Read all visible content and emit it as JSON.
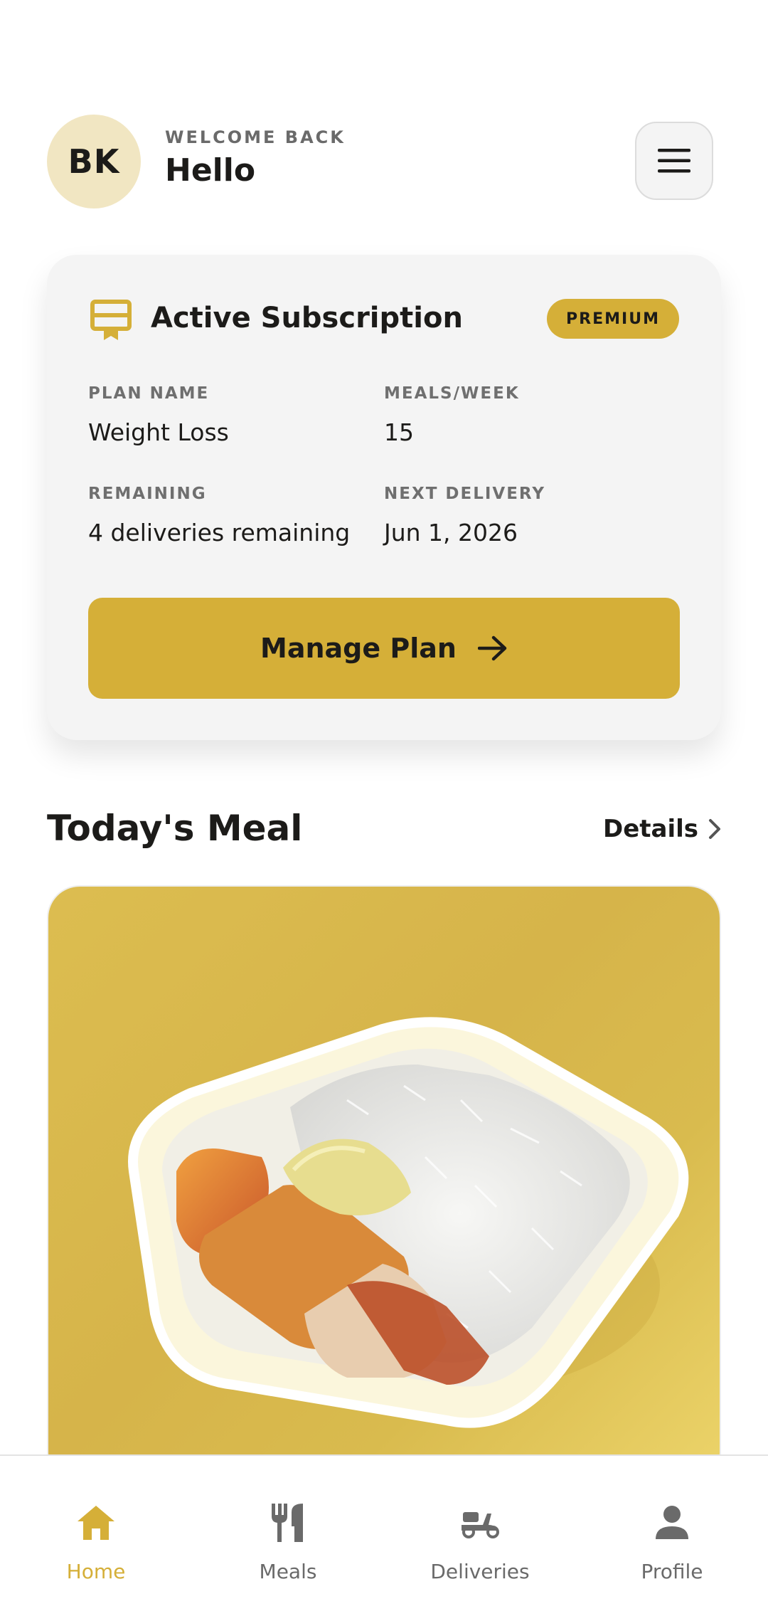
{
  "header": {
    "avatar_initials": "BK",
    "welcome_label": "WELCOME BACK",
    "greeting": "Hello"
  },
  "subscription": {
    "title": "Active Subscription",
    "badge": "PREMIUM",
    "plan_name_label": "PLAN NAME",
    "plan_name": "Weight Loss",
    "meals_week_label": "MEALS/WEEK",
    "meals_week": "15",
    "remaining_label": "REMAINING",
    "remaining": "4 deliveries remaining",
    "next_delivery_label": "NEXT DELIVERY",
    "next_delivery": "Jun 1, 2026",
    "manage_button": "Manage Plan"
  },
  "todays_meal": {
    "title": "Today's Meal",
    "details_link": "Details"
  },
  "bottom_nav": {
    "items": [
      {
        "label": "Home",
        "icon": "home-icon",
        "active": true
      },
      {
        "label": "Meals",
        "icon": "fork-knife-icon",
        "active": false
      },
      {
        "label": "Deliveries",
        "icon": "scooter-icon",
        "active": false
      },
      {
        "label": "Profile",
        "icon": "person-icon",
        "active": false
      }
    ]
  },
  "colors": {
    "accent": "#d5af38",
    "avatar_bg": "#f1e6c2",
    "card_bg": "#f4f4f4",
    "text": "#1c1b19",
    "muted": "#6a6a6a"
  }
}
